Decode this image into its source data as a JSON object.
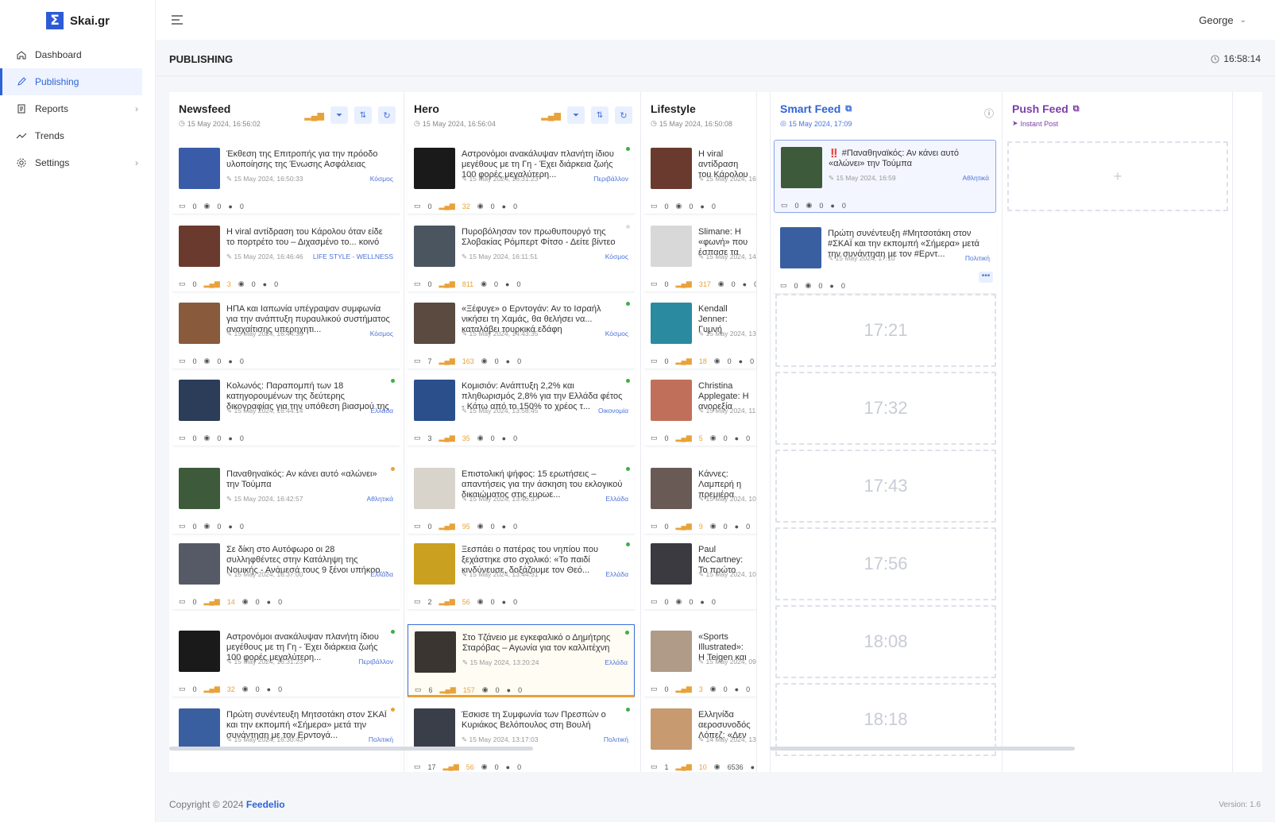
{
  "app": {
    "name": "Skai.gr",
    "logo_glyph": "Σ"
  },
  "sidebar": {
    "items": [
      {
        "label": "Dashboard",
        "icon": "home-icon",
        "active": false,
        "chevron": false
      },
      {
        "label": "Publishing",
        "icon": "pen-icon",
        "active": true,
        "chevron": false
      },
      {
        "label": "Reports",
        "icon": "document-icon",
        "active": false,
        "chevron": true
      },
      {
        "label": "Trends",
        "icon": "trend-icon",
        "active": false,
        "chevron": false
      },
      {
        "label": "Settings",
        "icon": "gear-icon",
        "active": false,
        "chevron": true
      }
    ]
  },
  "header": {
    "user": "George",
    "page_title": "PUBLISHING",
    "clock": "16:58:14"
  },
  "columns": {
    "newsfeed": {
      "title": "Newsfeed",
      "date": "15 May 2024, 16:56:02",
      "cards": [
        {
          "title": "Έκθεση της Επιτροπής για την πρόοδο υλοποίησης της Ένωσης Ασφάλειας",
          "time": "15 May 2024, 16:50:33",
          "cat": "Κόσμος",
          "comments": "0",
          "clicks": "",
          "views": "0",
          "shares": "0",
          "dot": "",
          "color": "#3a5ca8"
        },
        {
          "title": "Η viral αντίδραση του Κάρολου όταν είδε το πορτρέτο του – Διχασμένο το... κοινό",
          "time": "15 May 2024, 16:46:46",
          "cat": "LIFE STYLE - WELLNESS",
          "comments": "0",
          "clicks": "3",
          "views": "0",
          "shares": "0",
          "dot": "",
          "color": "#6b3a2e"
        },
        {
          "title": "ΗΠΑ και Ιαπωνία υπέγραψαν συμφωνία για την ανάπτυξη πυραυλικού συστήματος αναχαίτισης υπερηχητι...",
          "time": "15 May 2024, 16:44:35",
          "cat": "Κόσμος",
          "comments": "0",
          "clicks": "",
          "views": "0",
          "shares": "0",
          "dot": "",
          "color": "#8a5a3c"
        },
        {
          "title": "Κολωνός: Παραπομπή των 18 κατηγορουμένων της δεύτερης δικογραφίας για την υπόθεση βιασμού της 1...",
          "time": "15 May 2024, 16:44:14",
          "cat": "Ελλάδα",
          "comments": "0",
          "clicks": "",
          "views": "0",
          "shares": "0",
          "dot": "#3fae49",
          "color": "#2c3d5a"
        },
        {
          "title": "Παναθηναϊκός: Αν κάνει αυτό «αλώνει» την Τούμπα",
          "time": "15 May 2024, 16:42:57",
          "cat": "Αθλητικά",
          "comments": "0",
          "clicks": "",
          "views": "0",
          "shares": "0",
          "dot": "#e8a23a",
          "color": "#3d5a3a"
        },
        {
          "title": "Σε δίκη στο Αυτόφωρο οι 28 συλληφθέντες στην Κατάληψη της Νομικής - Ανάμεσά τους 9 ξένοι υπήκοο...",
          "time": "15 May 2024, 16:37:00",
          "cat": "Ελλάδα",
          "comments": "0",
          "clicks": "14",
          "views": "0",
          "shares": "0",
          "dot": "",
          "color": "#555a66"
        },
        {
          "title": "Αστρονόμοι ανακάλυψαν πλανήτη ίδιου μεγέθους με τη Γη - Έχει διάρκεια ζωής 100 φορές μεγαλύτερη...",
          "time": "15 May 2024, 16:31:23",
          "cat": "Περιβάλλον",
          "comments": "0",
          "clicks": "32",
          "views": "0",
          "shares": "0",
          "dot": "#3fae49",
          "color": "#1a1a1a"
        },
        {
          "title": "Πρώτη συνέντευξη Μητσοτάκη στον ΣΚΑΪ και την εκπομπή «Σήμερα» μετά την συνάντηση με τον Ερντογά...",
          "time": "15 May 2024, 16:30:43",
          "cat": "Πολιτική",
          "comments": "",
          "clicks": "",
          "views": "",
          "shares": "",
          "dot": "#e8a23a",
          "color": "#3a5fa0"
        }
      ]
    },
    "hero": {
      "title": "Hero",
      "date": "15 May 2024, 16:56:04",
      "cards": [
        {
          "title": "Αστρονόμοι ανακάλυψαν πλανήτη ίδιου μεγέθους με τη Γη - Έχει διάρκεια ζωής 100 φορές μεγαλύτερη...",
          "time": "15 May 2024, 16:31:23",
          "cat": "Περιβάλλον",
          "comments": "0",
          "clicks": "32",
          "views": "0",
          "shares": "0",
          "dot": "#3fae49",
          "color": "#1a1a1a"
        },
        {
          "title": "Πυροβόλησαν τον πρωθυπουργό της Σλοβακίας Ρόμπερτ Φίτσο - Δείτε βίντεο",
          "time": "15 May 2024, 16:11:51",
          "cat": "Κόσμος",
          "comments": "0",
          "clicks": "811",
          "views": "0",
          "shares": "0",
          "dot": "#dddddd",
          "color": "#4a5560"
        },
        {
          "title": "«Ξέφυγε» ο Ερντογάν: Αν το Ισραήλ νικήσει τη Χαμάς, θα θελήσει να... καταλάβει τουρκικά εδάφη",
          "time": "15 May 2024, 14:43:35",
          "cat": "Κόσμος",
          "comments": "7",
          "clicks": "163",
          "views": "0",
          "shares": "0",
          "dot": "#3fae49",
          "color": "#5a4a40"
        },
        {
          "title": "Κομισιόν: Ανάπτυξη 2,2% και πληθωρισμός 2,8% για την Ελλάδα φέτος - Κάτω από το 150% το χρέος τ...",
          "time": "15 May 2024, 13:58:45",
          "cat": "Οικονομία",
          "comments": "3",
          "clicks": "35",
          "views": "0",
          "shares": "0",
          "dot": "#3fae49",
          "color": "#2a4f8a"
        },
        {
          "title": "Επιστολική ψήφος: 15 ερωτήσεις – απαντήσεις για την άσκηση του εκλογικού δικαιώματος στις ευρωε...",
          "time": "15 May 2024, 13:46:37",
          "cat": "Ελλάδα",
          "comments": "0",
          "clicks": "95",
          "views": "0",
          "shares": "0",
          "dot": "#3fae49",
          "color": "#d8d4cc"
        },
        {
          "title": "Ξεσπάει ο πατέρας του νηπίου που ξεχάστηκε στο σχολικό: «Το παιδί κινδύνευσε, δοξάζουμε τον Θεό...",
          "time": "15 May 2024, 13:44:31",
          "cat": "Ελλάδα",
          "comments": "2",
          "clicks": "56",
          "views": "0",
          "shares": "0",
          "dot": "#3fae49",
          "color": "#caa020"
        },
        {
          "title": "Στο Τζάνειο με εγκεφαλικό ο Δημήτρης Σταρόβας – Αγωνία για τον καλλιτέχνη",
          "time": "15 May 2024, 13:20:24",
          "cat": "Ελλάδα",
          "comments": "6",
          "clicks": "157",
          "views": "0",
          "shares": "0",
          "dot": "#3fae49",
          "color": "#3a3530"
        },
        {
          "title": "Έσκισε τη Συμφωνία των Πρεσπών ο Κυριάκος Βελόπουλος στη Βουλή",
          "time": "15 May 2024, 13:17:03",
          "cat": "Πολιτική",
          "comments": "17",
          "clicks": "56",
          "views": "0",
          "shares": "0",
          "dot": "#3fae49",
          "color": "#3a3e48"
        }
      ]
    },
    "lifestyle": {
      "title": "Lifestyle",
      "date": "15 May 2024, 16:50:08",
      "cards": [
        {
          "title": "Η viral αντίδραση του Κάρολου όταν είδε το πορτρέτο του - Διχασμένο το... κοινό",
          "time": "15 May 2024, 16:46:46",
          "cat": "",
          "comments": "0",
          "clicks": "",
          "views": "0",
          "shares": "0",
          "color": "#6b3a2e"
        },
        {
          "title": "Slimane: Η «φωνή» που έσπασε τα ρεκόρ με ένα συγκινητικό «ευχαριστώ»",
          "time": "15 May 2024, 14:32:11",
          "cat": "",
          "comments": "0",
          "clicks": "317",
          "views": "0",
          "shares": "0",
          "color": "#d8d8d8"
        },
        {
          "title": "Kendall Jenner: Γυμνή καμπάνια για μαγιό",
          "time": "15 May 2024, 13:45:02",
          "cat": "",
          "comments": "0",
          "clicks": "18",
          "views": "0",
          "shares": "0",
          "color": "#2a8aa0"
        },
        {
          "title": "Christina Applegate: Η ανορεξία όταν πρωταγωνιστούσε «Παντρεμένοι με παιδιά»",
          "time": "15 May 2024, 11:12:30",
          "cat": "",
          "comments": "0",
          "clicks": "5",
          "views": "0",
          "shares": "0",
          "color": "#c0705a"
        },
        {
          "title": "Κάννες: Λαμπερή η πρεμιέρα συγκινητική και ιδιαίτερη - Βίντεο, φωτογραφίες",
          "time": "15 May 2024, 10:55:40",
          "cat": "",
          "comments": "0",
          "clicks": "9",
          "views": "0",
          "shares": "0",
          "color": "#6a5a55"
        },
        {
          "title": "Paul McCartney: Το πρώτο μπότες του από το Ολυμπιακών Αγώνων",
          "time": "15 May 2024, 10:24:18",
          "cat": "",
          "comments": "0",
          "clicks": "",
          "views": "0",
          "shares": "0",
          "color": "#3a3a40"
        },
        {
          "title": "«Sports Illustrated»: Η Teigen και άλλες στο επετειακό τους εξώφυλλο",
          "time": "15 May 2024, 09:50:22",
          "cat": "",
          "comments": "0",
          "clicks": "3",
          "views": "0",
          "shares": "0",
          "color": "#b09a88"
        },
        {
          "title": "Ελληνίδα αεροσυνοδός: Λόπεζ: «Δεν ήθελα να Κατέβηκε από το αεροπλάνο",
          "time": "14 May 2024, 13:36:05",
          "cat": "",
          "comments": "1",
          "clicks": "10",
          "views": "6536",
          "shares": "393",
          "color": "#c89a70"
        }
      ]
    },
    "smartfeed": {
      "title": "Smart Feed",
      "date": "15 May 2024, 17:09",
      "cards": [
        {
          "title": "‼️ #Παναθηναϊκός: Αν κάνει αυτό «αλώνει» την Τούμπα",
          "time": "15 May 2024, 16:59",
          "cat": "Αθλητικά",
          "comments": "0",
          "views": "0",
          "shares": "0",
          "color": "#3d5a3a"
        },
        {
          "title": "Πρώτη συνέντευξη #Μητσοτάκη στον #ΣΚΑΪ και την εκπομπή «Σήμερα» μετά την συνάντηση με τον #Ερντ...",
          "time": "15 May 2024, 17:10",
          "cat": "Πολιτική",
          "comments": "0",
          "views": "0",
          "shares": "0",
          "color": "#3a5fa0"
        }
      ],
      "slots": [
        "17:21",
        "17:32",
        "17:43",
        "17:56",
        "18:08",
        "18:18"
      ]
    },
    "pushfeed": {
      "title": "Push Feed",
      "sub": "Instant Post",
      "add": "+"
    }
  },
  "footer": {
    "copyright": "Copyright © 2024",
    "brand": "Feedelio",
    "version": "Version: 1.6"
  },
  "colors": {
    "accent": "#2e63d6",
    "purple": "#7b3fa8",
    "orange": "#e8a23a",
    "green": "#3fae49"
  }
}
